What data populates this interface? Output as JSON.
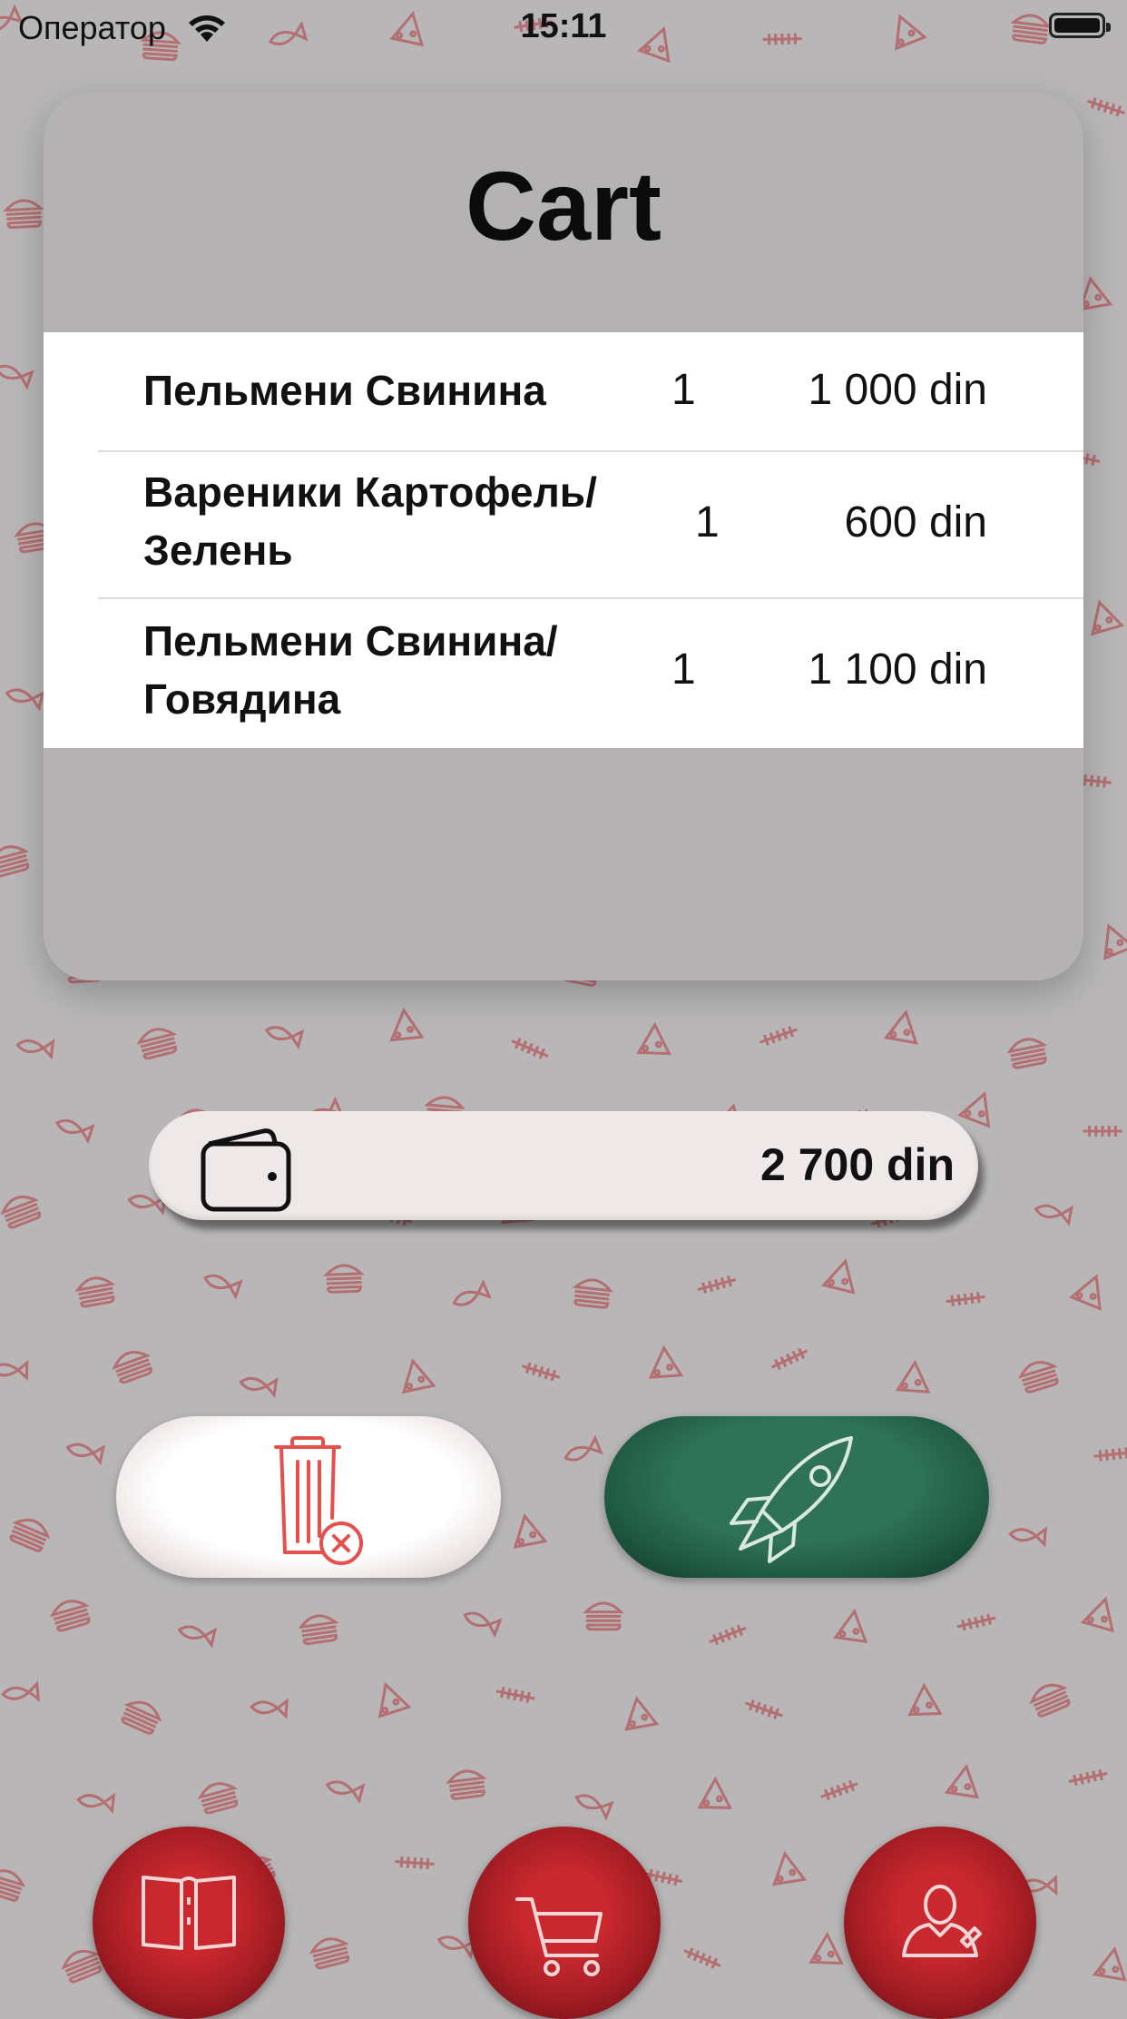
{
  "status_bar": {
    "carrier": "Оператор",
    "time": "15:11",
    "wifi_icon": "wifi-icon",
    "battery_icon": "battery-icon"
  },
  "cart": {
    "title": "Cart",
    "items": [
      {
        "name_line1": "Пельмени Свинина",
        "name_line2": "",
        "qty": "1",
        "price": "1 000 din"
      },
      {
        "name_line1": "Вареники Картофель/",
        "name_line2": "Зелень",
        "qty": "1",
        "price": "600 din"
      },
      {
        "name_line1": "Пельмени Свинина/",
        "name_line2": "Говядина",
        "qty": "1",
        "price": "1 100 din"
      }
    ]
  },
  "total": {
    "icon": "wallet-icon",
    "amount": "2 700 din"
  },
  "actions": {
    "clear_icon": "trash-clear-icon",
    "order_icon": "rocket-icon"
  },
  "tab_bar": {
    "items": [
      {
        "icon": "menu-book-icon"
      },
      {
        "icon": "shopping-cart-icon"
      },
      {
        "icon": "profile-icon"
      }
    ]
  },
  "colors": {
    "background": "#b8b6b6",
    "pattern": "#b0353a",
    "order_green": "#2e7257",
    "tab_red": "#c8282e",
    "clear_red": "#e5504c"
  }
}
